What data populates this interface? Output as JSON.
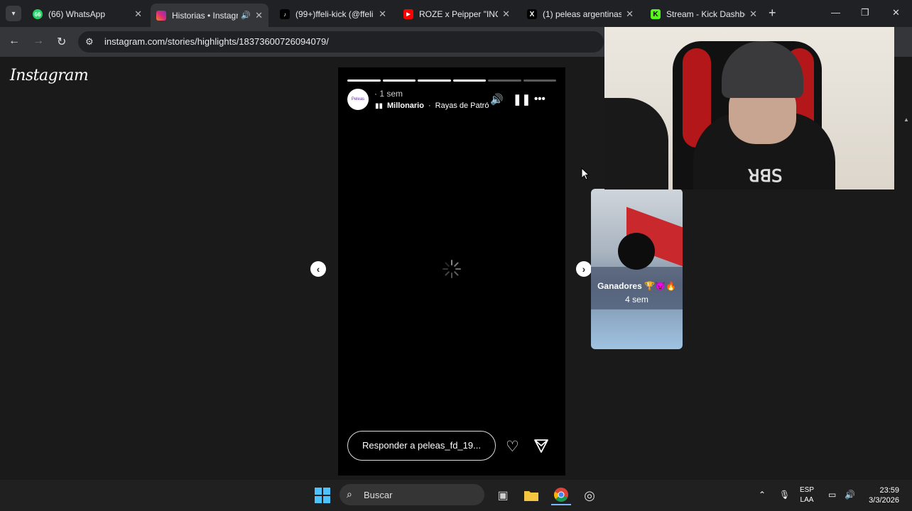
{
  "browser": {
    "tabs": [
      {
        "title": "(66) WhatsApp",
        "badge": "66",
        "favicon_color": "#25d366"
      },
      {
        "title": "Historias • Instagram",
        "favicon_color": "#e1306c",
        "audio": true,
        "active": true
      },
      {
        "title": "(99+)ffeli-kick (@ffeli",
        "favicon_color": "#000000"
      },
      {
        "title": "ROZE x Peipper \"INO",
        "favicon_color": "#ff0000"
      },
      {
        "title": "(1) peleas argentinas",
        "favicon_color": "#000000"
      },
      {
        "title": "Stream - Kick Dashbo",
        "favicon_color": "#53fc18"
      }
    ],
    "url": "instagram.com/stories/highlights/18373600726094079/"
  },
  "instagram": {
    "logo": "Instagram",
    "story": {
      "avatar_text": "Peleas",
      "time": "1 sem",
      "song": "Millonario",
      "artist": "Rayas de Patró",
      "progress_total": 6,
      "progress_done": 4,
      "reply_placeholder": "Responder a peleas_fd_19..."
    },
    "next_highlight": {
      "title": "Ganadores 🏆😈🔥",
      "time": "4 sem"
    }
  },
  "taskbar": {
    "search_label": "Buscar",
    "lang_line1": "ESP",
    "lang_line2": "LAA",
    "time": "23:59",
    "date": "3/3/2026"
  }
}
